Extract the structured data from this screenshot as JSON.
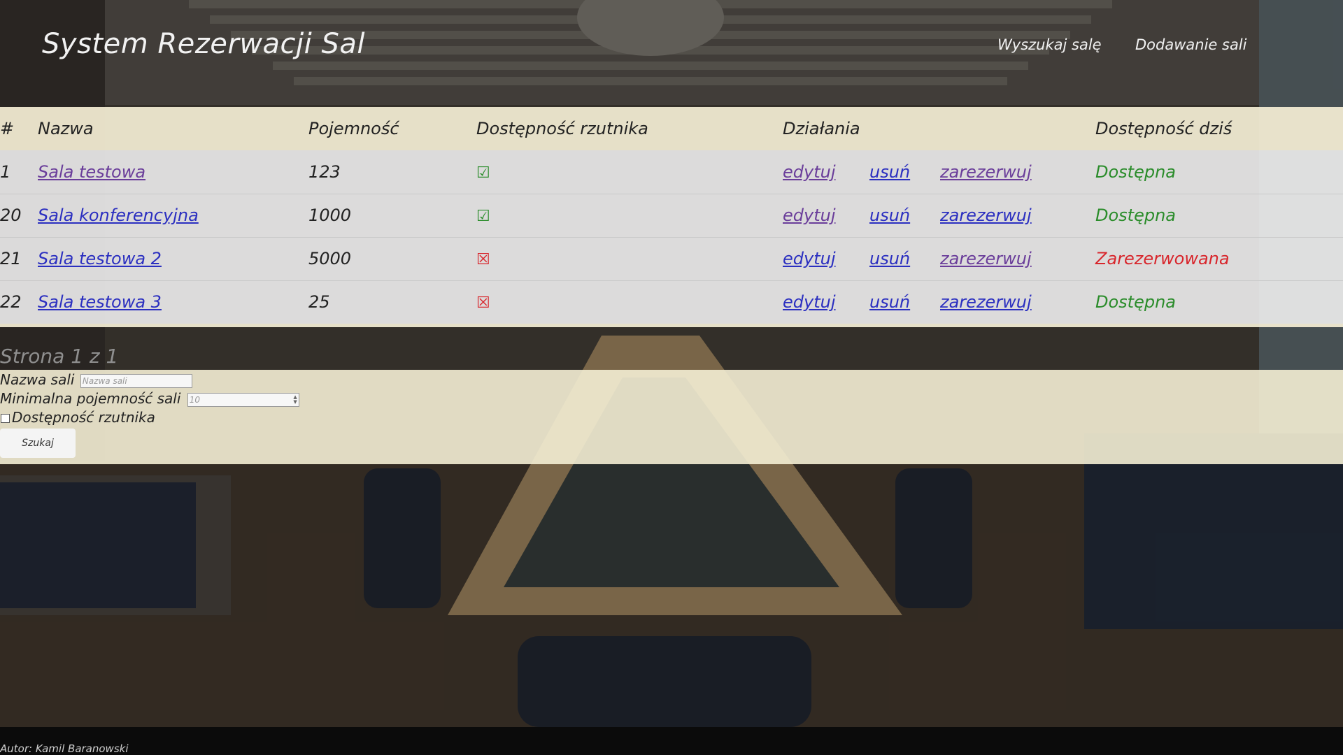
{
  "header": {
    "title": "System Rezerwacji Sal",
    "nav": [
      "Wyszukaj salę",
      "Dodawanie sali"
    ]
  },
  "table": {
    "columns": [
      "#",
      "Nazwa",
      "Pojemność",
      "Dostępność rzutnika",
      "Działania",
      "Dostępność dziś"
    ],
    "rows": [
      {
        "id": "1",
        "name": "Sala testowa",
        "capacity": "123",
        "projector": "☑",
        "actions": [
          "edytuj",
          "usuń",
          "zarezerwuj"
        ],
        "availability": "Dostępna"
      },
      {
        "id": "20",
        "name": "Sala konferencyjna",
        "capacity": "1000",
        "projector": "☑",
        "actions": [
          "edytuj",
          "usuń",
          "zarezerwuj"
        ],
        "availability": "Dostępna"
      },
      {
        "id": "21",
        "name": "Sala testowa 2",
        "capacity": "5000",
        "projector": "☒",
        "actions": [
          "edytuj",
          "usuń",
          "zarezerwuj"
        ],
        "availability": "Zarezerwowana"
      },
      {
        "id": "22",
        "name": "Sala testowa 3",
        "capacity": "25",
        "projector": "☒",
        "actions": [
          "edytuj",
          "usuń",
          "zarezerwuj"
        ],
        "availability": "Dostępna"
      }
    ]
  },
  "pager": "Strona 1 z 1",
  "search": {
    "name_label": "Nazwa sali",
    "name_placeholder": "Nazwa sali",
    "capacity_label": "Minimalna pojemność sali",
    "capacity_value": "10",
    "projector_label": "Dostępność rzutnika",
    "projector_checked": false,
    "submit": "Szukaj"
  },
  "footer": "Autor: Kamil Baranowski",
  "colors": {
    "available": "#2a8c2a",
    "reserved": "#d8262c",
    "link": "#2b2fc0",
    "visited_link": "#6a3d9a",
    "panel": "#f4eed4"
  }
}
